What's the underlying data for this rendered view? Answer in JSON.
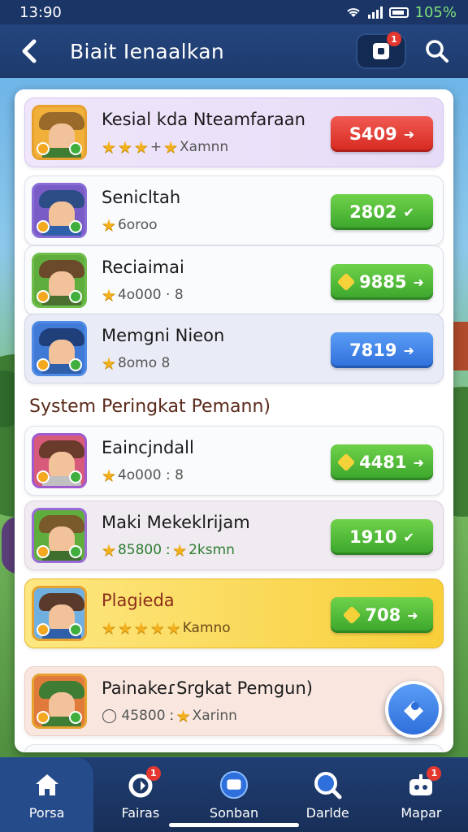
{
  "status_bar": {
    "time": "13:90",
    "battery": "105%"
  },
  "header": {
    "title": "Biait Ienaalkan",
    "notification_count": "1"
  },
  "rows": [
    {
      "name": "Kesial kda  Nteamfaraan",
      "meta": "★★★ + ★ Xamnn",
      "stars": 3,
      "action_value": "S409",
      "action_color": "#e0332a"
    },
    {
      "name": "Senicltah",
      "meta": "★ 6oroo",
      "stars": 1,
      "action_value": "2802",
      "action_color": "#4bb836"
    },
    {
      "name": "Reciaimai",
      "meta": "★ 4o000 · 8",
      "stars": 1,
      "action_value": "9885",
      "action_color": "#4bb836"
    },
    {
      "name": "Memgni Nieon",
      "meta": "★ 8omo   8",
      "stars": 1,
      "action_value": "7819",
      "action_color": "#3b80e6"
    }
  ],
  "section": {
    "title": "System Peringkat Pemann)"
  },
  "rows2": [
    {
      "name": "Eaincjndall",
      "meta": "★ 4o000 : 8",
      "action_value": "4481"
    },
    {
      "name": "Maki Mekeklrijam",
      "meta": "★ 85800 ː ★ 2ksmn",
      "action_value": "1910"
    },
    {
      "name": "Plagieda",
      "meta": "★★★ ★ ★ Kamno",
      "action_value": "708"
    },
    {
      "name": "PainakeɾSrgkat Pemgun)",
      "meta": "◯ 45800 ː ★ Xarinn"
    }
  ],
  "bottom_nav": [
    {
      "label": "Porsa",
      "icon": "home-icon",
      "badge": ""
    },
    {
      "label": "Fairas",
      "icon": "heart-icon",
      "badge": "1"
    },
    {
      "label": "Sonban",
      "icon": "chat-icon",
      "badge": ""
    },
    {
      "label": "Darlde",
      "icon": "search-icon",
      "badge": ""
    },
    {
      "label": "Mapar",
      "icon": "robot-icon",
      "badge": "1"
    }
  ],
  "colors": {
    "header": "#1d3a6c",
    "gold_row": "#f8cf3a",
    "red": "#e0332a",
    "green": "#4bb836",
    "blue": "#3b80e6"
  }
}
